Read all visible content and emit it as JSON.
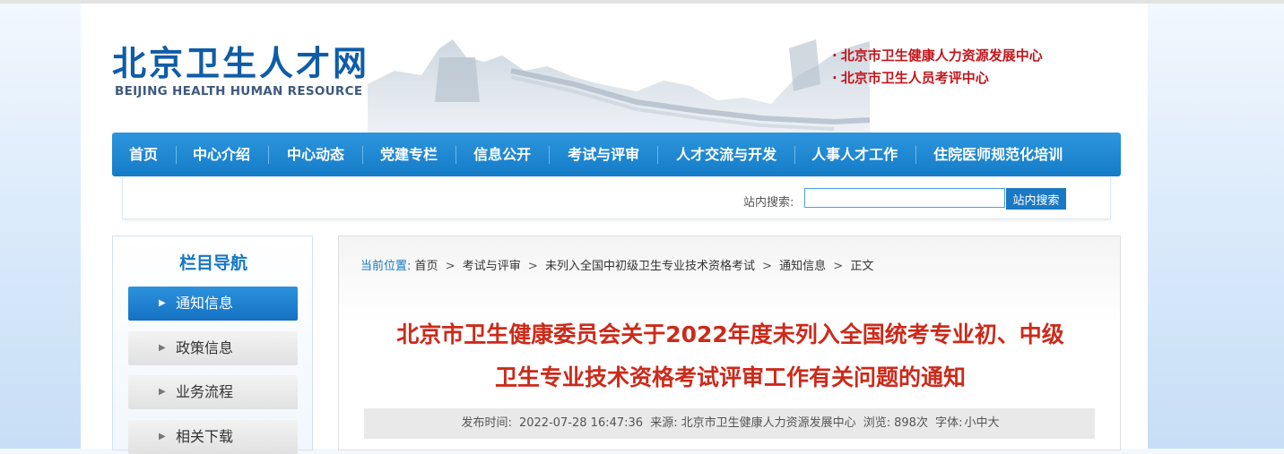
{
  "header": {
    "logo_cn": "北京卫生人才网",
    "logo_en": "BEIJING HEALTH HUMAN RESOURCE",
    "org_links": [
      {
        "label": "北京市卫生健康人力资源发展中心"
      },
      {
        "label": "北京市卫生人员考评中心"
      }
    ],
    "bullet": "·"
  },
  "nav": {
    "items": [
      {
        "label": "首页"
      },
      {
        "label": "中心介绍"
      },
      {
        "label": "中心动态"
      },
      {
        "label": "党建专栏"
      },
      {
        "label": "信息公开"
      },
      {
        "label": "考试与评审"
      },
      {
        "label": "人才交流与开发"
      },
      {
        "label": "人事人才工作"
      },
      {
        "label": "住院医师规范化培训"
      }
    ]
  },
  "search": {
    "label": "站内搜索:",
    "value": "",
    "button": "站内搜索"
  },
  "sidebar": {
    "title": "栏目导航",
    "items": [
      {
        "label": "通知信息",
        "active": true
      },
      {
        "label": "政策信息",
        "active": false
      },
      {
        "label": "业务流程",
        "active": false
      },
      {
        "label": "相关下载",
        "active": false
      }
    ],
    "arrow": "▶"
  },
  "breadcrumb": {
    "label": "当前位置:",
    "items": [
      "首页",
      "考试与评审",
      "未列入全国中初级卫生专业技术资格考试",
      "通知信息",
      "正文"
    ],
    "sep": ">"
  },
  "article": {
    "title_line1": "北京市卫生健康委员会关于2022年度未列入全国统考专业初、中级",
    "title_line2": "卫生专业技术资格考试评审工作有关问题的通知",
    "meta": {
      "publish_label": "发布时间:",
      "publish_time": "2022-07-28 16:47:36",
      "source_label": "来源:",
      "source": "北京市卫生健康人力资源发展中心",
      "views_label": "浏览:",
      "views": "898次",
      "font_label": "字体:",
      "font_small": "小",
      "font_medium": "中",
      "font_large": "大"
    }
  },
  "colors": {
    "brand_blue": "#1577c4",
    "title_red": "#cc2a1a",
    "org_red": "#c3161c"
  }
}
